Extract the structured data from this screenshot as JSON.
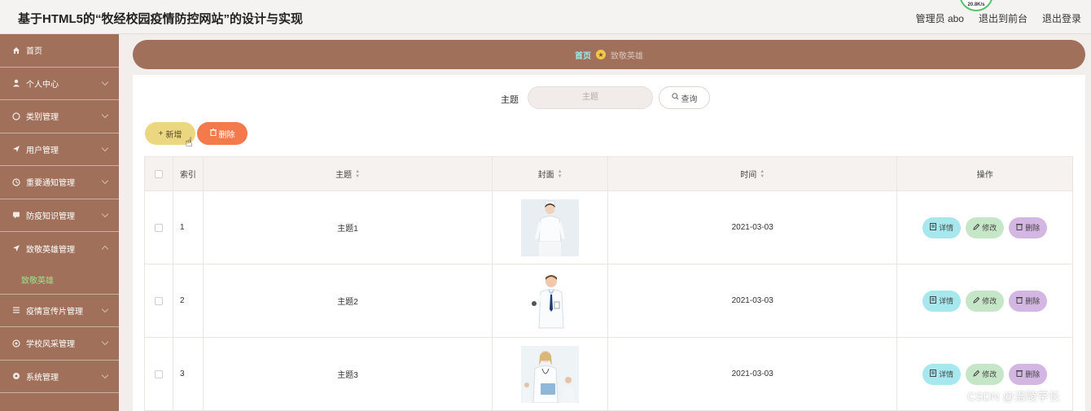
{
  "header": {
    "title": "基于HTML5的“牧经校园疫情防控网站”的设计与实现",
    "net_speed": "20.8K/s",
    "admin_label": "管理员 abo",
    "front_label": "退出到前台",
    "logout_label": "退出登录"
  },
  "sidebar": {
    "items": [
      {
        "label": "首页",
        "icon": "home-icon"
      },
      {
        "label": "个人中心",
        "icon": "user-icon"
      },
      {
        "label": "类别管理",
        "icon": "category-icon"
      },
      {
        "label": "用户管理",
        "icon": "send-icon"
      },
      {
        "label": "重要通知管理",
        "icon": "clock-icon"
      },
      {
        "label": "防疫知识管理",
        "icon": "message-icon"
      },
      {
        "label": "致敬英雄管理",
        "icon": "navigation-icon"
      },
      {
        "label": "疫情宣传片管理",
        "icon": "video-icon"
      },
      {
        "label": "学校风采管理",
        "icon": "school-icon"
      },
      {
        "label": "系统管理",
        "icon": "settings-icon"
      }
    ],
    "active_sub": "致敬英雄"
  },
  "breadcrumb": {
    "home": "首页",
    "current": "致敬英雄"
  },
  "search": {
    "label": "主题",
    "placeholder": "主题",
    "button": "查询"
  },
  "actions": {
    "add": "新增",
    "delete": "删除"
  },
  "table": {
    "columns": [
      "索引",
      "主题",
      "封面",
      "时间",
      "操作"
    ],
    "rows": [
      {
        "index": "1",
        "title": "主题1",
        "time": "2021-03-03",
        "cover": "nurse-photo"
      },
      {
        "index": "2",
        "title": "主题2",
        "time": "2021-03-03",
        "cover": "doctor-photo"
      },
      {
        "index": "3",
        "title": "主题3",
        "time": "2021-03-03",
        "cover": "medical-team-photo"
      }
    ],
    "op_detail": "详情",
    "op_edit": "修改",
    "op_delete": "删除"
  },
  "watermark": "CSDN @涪陵学长",
  "colors": {
    "sidebar": "#a0705a",
    "active_submenu": "#9de38c",
    "add_button": "#ebd780",
    "delete_button": "#f47a4c",
    "detail_button": "#a7e7ee",
    "edit_button": "#c6e7c7",
    "row_delete_button": "#d4b6e3"
  }
}
